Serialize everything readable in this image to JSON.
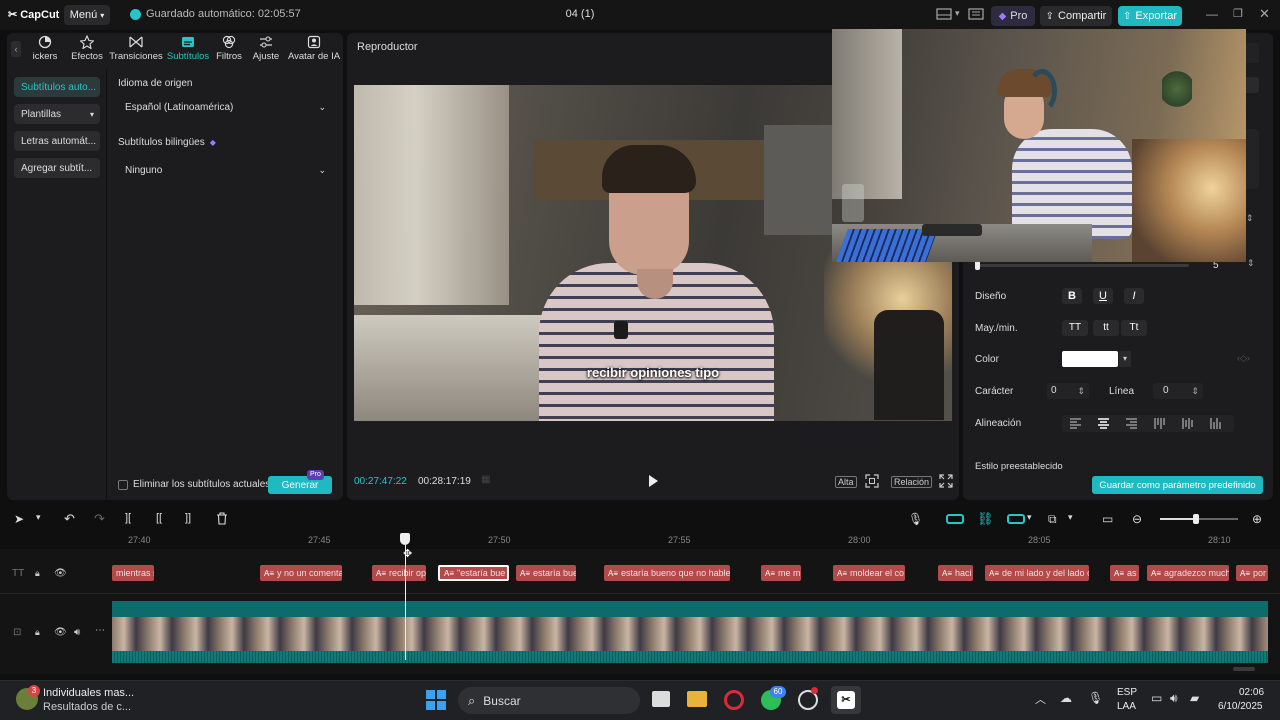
{
  "app": {
    "logo": "CapCut",
    "menu_label": "Menú",
    "autosave": "Guardado automático: 02:05:57",
    "project": "04 (1)",
    "pro_label": "Pro",
    "share_label": "Compartir",
    "export_label": "Exportar",
    "accent": "#26c6c6"
  },
  "left_panel": {
    "tabs": [
      {
        "label": "ickers",
        "icon": "sticker-icon"
      },
      {
        "label": "Efectos",
        "icon": "effects-icon"
      },
      {
        "label": "Transiciones",
        "icon": "transitions-icon"
      },
      {
        "label": "Subtítulos",
        "icon": "subtitles-icon"
      },
      {
        "label": "Filtros",
        "icon": "filters-icon"
      },
      {
        "label": "Ajuste",
        "icon": "adjust-icon"
      },
      {
        "label": "Avatar de IA",
        "icon": "ai-avatar-icon"
      }
    ],
    "subnav": [
      "Subtítulos auto...",
      "Plantillas",
      "Letras automát...",
      "Agregar subtít..."
    ],
    "source_language_label": "Idioma de origen",
    "source_language_value": "Español (Latinoamérica)",
    "bilingual_label": "Subtítulos bilingües",
    "bilingual_value": "Ninguno",
    "remove_current_label": "Eliminar los subtítulos actuales",
    "generate_label": "Generar",
    "generate_badge": "Pro"
  },
  "player": {
    "title": "Reproductor",
    "caption": "recibir opiniones tipo",
    "current_time": "00:27:47:22",
    "total_time": "00:28:17:19",
    "quality_label": "Alta",
    "ratio_label": "Relación"
  },
  "right_panel": {
    "slider_value": "5",
    "design_label": "Diseño",
    "case_label": "May./min.",
    "case_opts": [
      "TT",
      "tt",
      "Tt"
    ],
    "color_label": "Color",
    "char_label": "Carácter",
    "char_value": "0",
    "line_label": "Línea",
    "line_value": "0",
    "align_label": "Alineación",
    "preset_label": "Estilo preestablecido",
    "save_preset_label": "Guardar como parámetro predefinido"
  },
  "timeline": {
    "ruler": [
      "27:40",
      "27:45",
      "27:50",
      "27:55",
      "28:00",
      "28:05",
      "28:10"
    ],
    "clips": [
      "mientras se",
      "y no un comenta",
      "recibir op",
      "\"estaría bue",
      "estaría bue",
      "estaría bueno que no hable",
      "me me ir",
      "moldear el co",
      "haci",
      "de mi lado y del lado d",
      "as",
      "agradezco much",
      "por"
    ]
  },
  "taskbar": {
    "notif_title": "Individuales mas...",
    "notif_sub": "Resultados de c...",
    "notif_badge": "3",
    "search_label": "Buscar",
    "whatsapp_badge": "60",
    "lang_top": "ESP",
    "lang_bottom": "LAA",
    "time": "02:06",
    "date": "6/10/2025"
  }
}
